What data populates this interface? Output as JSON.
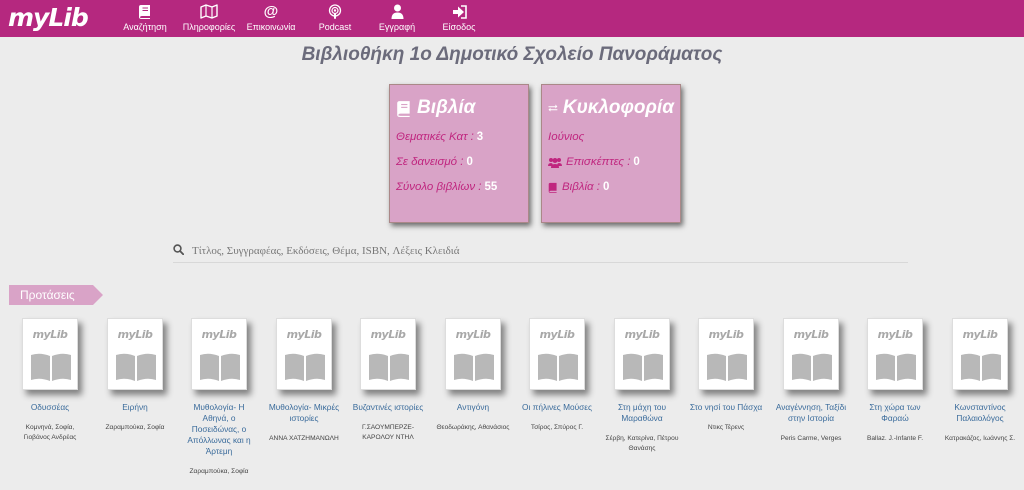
{
  "header": {
    "logo": "myLib",
    "nav": [
      {
        "label": "Αναζήτηση",
        "icon": "book-icon"
      },
      {
        "label": "Πληροφορίες",
        "icon": "map-icon"
      },
      {
        "label": "Επικοινωνία",
        "icon": "at-icon"
      },
      {
        "label": "Podcast",
        "icon": "podcast-icon"
      },
      {
        "label": "Εγγραφή",
        "icon": "user-icon"
      },
      {
        "label": "Είσοδος",
        "icon": "sign-in-icon"
      }
    ]
  },
  "page_title": "Βιβλιοθήκη 1ο Δημοτικό Σχολείο Πανοράματος",
  "books_card": {
    "title": "Βιβλία",
    "thematic_label": "Θεματικές Κατ :",
    "thematic_value": "3",
    "loaned_label": "Σε δανεισμό :",
    "loaned_value": "0",
    "total_label": "Σύνολο βιβλίων :",
    "total_value": "55"
  },
  "circulation_card": {
    "title": "Κυκλοφορία",
    "month": "Ιούνιος",
    "visitors_label": "Επισκέπτες :",
    "visitors_value": "0",
    "books_label": "Βιβλία :",
    "books_value": "0"
  },
  "search": {
    "placeholder": "Τίτλος, Συγγραφέας, Εκδόσεις, Θέμα, ISBN, Λέξεις Κλειδιά"
  },
  "suggestions_label": "Προτάσεις",
  "cover_logo": "myLib",
  "books": [
    {
      "title": "Οδυσσέας",
      "author": "Κομνηνά, Σοφία, Γιοβάνος Ανδρέας"
    },
    {
      "title": "Ειρήνη",
      "author": "Ζαραμπούκα, Σοφία"
    },
    {
      "title": "Μυθολογία- Η Αθηνά, ο Ποσειδώνας, ο Απόλλωνας και η Άρτεμη",
      "author": "Ζαραμπούκα, Σοφία"
    },
    {
      "title": "Μυθολογία- Μικρές ιστορίες",
      "author": "ΑΝΝΑ ΧΑΤΖΗΜΑΝΩΛΗ"
    },
    {
      "title": "Βυζαντινές ιστορίες",
      "author": "Γ.ΣΑΟΥΜΠΕΡΖΕ-ΚΑΡΟΛΟΥ ΝΤΗΛ"
    },
    {
      "title": "Αντιγόνη",
      "author": "Θεοδωράκης, Αθανάσιος"
    },
    {
      "title": "Οι πήλινες Μούσες",
      "author": "Τσίρος, Σπύρος Γ."
    },
    {
      "title": "Στη μάχη του Μαραθώνα",
      "author": "Σέρβη, Κατερίνα, Πέτρου Θανάσης"
    },
    {
      "title": "Στο νησί του Πάσχα",
      "author": "Ντικς Τέρενς"
    },
    {
      "title": "Αναγέννηση, Ταξίδι στην Ιστορία",
      "author": "Peris Carme, Verges"
    },
    {
      "title": "Στη χώρα των Φαραώ",
      "author": "Ballaz. J.-Infante F."
    },
    {
      "title": "Κωνσταντίνος Παλαιολόγος",
      "author": "Κατρακάζος, Ιωάννης Σ."
    }
  ]
}
